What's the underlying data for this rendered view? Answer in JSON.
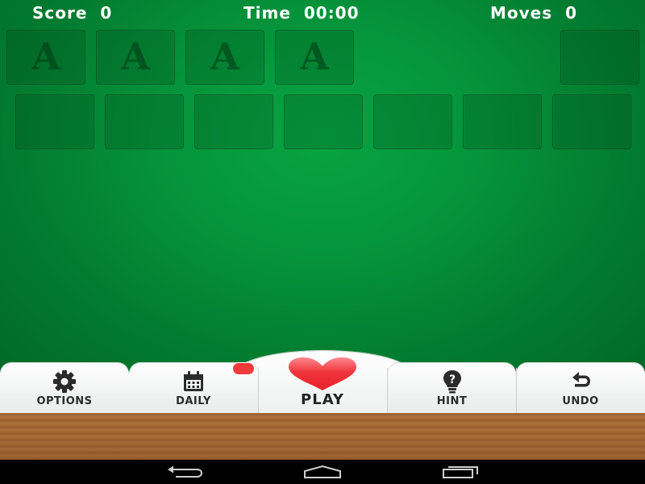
{
  "hud": {
    "score_label": "Score",
    "score_value": "0",
    "time_label": "Time",
    "time_value": "00:00",
    "moves_label": "Moves",
    "moves_value": "0"
  },
  "foundations": [
    "A",
    "A",
    "A",
    "A"
  ],
  "toolbar": {
    "options_label": "OPTIONS",
    "daily_label": "DAILY",
    "play_label": "PLAY",
    "hint_label": "HINT",
    "undo_label": "UNDO"
  },
  "icons": {
    "options": "gear-icon",
    "daily": "calendar-icon",
    "play": "heart-icon",
    "hint": "lightbulb-question-icon",
    "undo": "undo-arrow-icon"
  },
  "colors": {
    "felt": "#05943b",
    "heart": "#f0343c",
    "badge": "#ef3b3b",
    "wood": "#a96c38"
  }
}
